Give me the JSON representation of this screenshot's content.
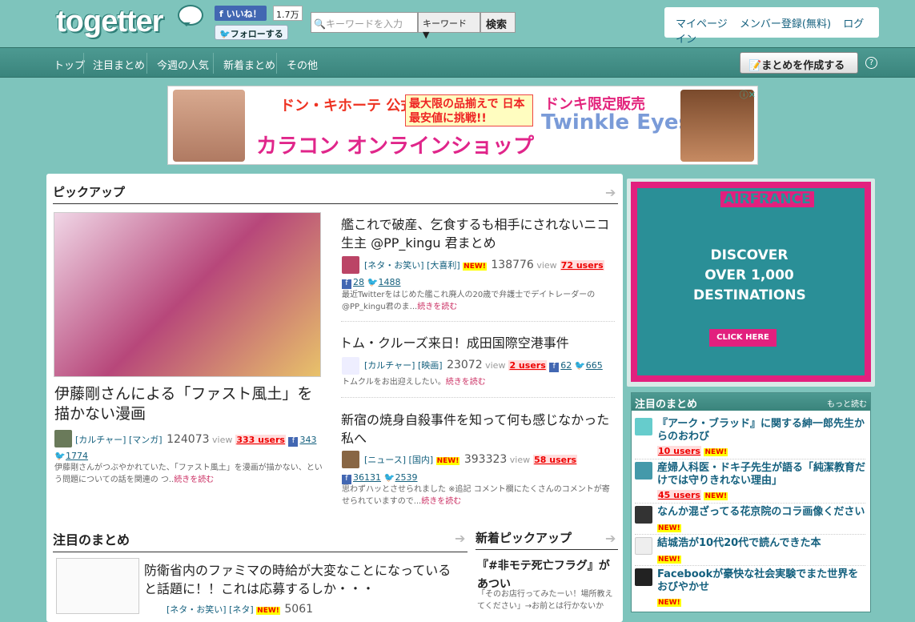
{
  "header": {
    "logo": "togetter",
    "fb_like": "いいね！",
    "fb_count": "1.7万",
    "tw_follow": "フォローする",
    "search_placeholder": "キーワードを入力",
    "search_select": "キーワード",
    "search_button": "検索",
    "user_links": [
      "マイページ",
      "メンバー登録(無料)",
      "ログイン"
    ]
  },
  "nav": {
    "items": [
      "トップ",
      "注目まとめ",
      "今週の人気",
      "新着まとめ",
      "その他"
    ],
    "create_button": "まとめを作成する",
    "help": "?"
  },
  "banner": {
    "line1": "ドン・キホーテ 公式サイトはここだけ",
    "line2": "カラコン オンラインショップ",
    "box": "最大限の品揃えで 日本最安値に挑戦!!",
    "brand_top": "ドンキ限定販売",
    "brand": "Twinkle Eyes"
  },
  "pickup": {
    "title": "ピックアップ",
    "featured": {
      "title": "伊藤剛さんによる「ファスト風土」を描かない漫画",
      "category": "[カルチャー] [マンガ]",
      "views": "124073",
      "view_label": "view",
      "users": "333 users",
      "fb": "343",
      "tw": "1774",
      "desc": "伊藤剛さんがつぶやかれていた、「ファスト風土」を漫画が描かない、という問題についての話を関連の つ..",
      "more": "続きを読む"
    },
    "items": [
      {
        "title": "艦これで破産、乞食するも相手にされないニコ生主 @PP_kingu 君まとめ",
        "category": "[ネタ・お笑い] [大喜利]",
        "new": "NEW!",
        "views": "138776",
        "users": "72 users",
        "fb": "28",
        "tw": "1488",
        "desc": "最近Twitterをはじめた艦これ廃人の20歳で弁護士でデイトレーダーの@PP_kingu君のま...",
        "more": "続きを読む"
      },
      {
        "title": "トム・クルーズ来日！成田国際空港事件",
        "category": "[カルチャー] [映画]",
        "views": "23072",
        "users": "2 users",
        "fb": "62",
        "tw": "665",
        "desc": "トムクルをお出迎えしたい。",
        "more": "続きを読む"
      },
      {
        "title": "新宿の焼身自殺事件を知って何も感じなかった私へ",
        "category": "[ニュース] [国内]",
        "new": "NEW!",
        "views": "393323",
        "users": "58 users",
        "fb": "36131",
        "tw": "2539",
        "desc": "思わずハッとさせられました ※追記 コメント欄にたくさんのコメントが寄せられていますので...",
        "more": "続きを読む"
      }
    ]
  },
  "featured_section": {
    "title": "注目のまとめ",
    "item": {
      "title": "防衛省内のファミマの時給が大変なことになっていると話題に！！これは応募するしか・・・",
      "category": "[ネタ・お笑い] [ネタ]",
      "new": "NEW!",
      "views": "5061"
    }
  },
  "new_pickup": {
    "title": "新着ピックアップ",
    "item": {
      "title": "『#非モテ死亡フラグ』があつい",
      "desc": "「そのお店行ってみたーい！場所教えてください」→お前とは行かないか"
    }
  },
  "ad_side": {
    "brand": "AIRFRANCE",
    "text": "DISCOVER OVER 1,000 DESTINATIONS",
    "cta": "CLICK HERE"
  },
  "popular": {
    "title": "注目のまとめ",
    "more": "もっと読む",
    "items": [
      {
        "title": "『アーク・ブラッド』に関する紳一郎先生からのおわび",
        "users": "10 users",
        "new": "NEW!"
      },
      {
        "title": "産婦人科医・ドキ子先生が語る「純潔教育だけでは守りきれない理由」",
        "users": "45 users",
        "new": "NEW!"
      },
      {
        "title": "なんか混ざってる花京院のコラ画像ください",
        "new": "NEW!"
      },
      {
        "title": "結城浩が10代20代で読んできた本",
        "new": "NEW!"
      },
      {
        "title": "Facebookが豪快な社会実験でまた世界をおびやかせ",
        "new": "NEW!"
      }
    ]
  }
}
